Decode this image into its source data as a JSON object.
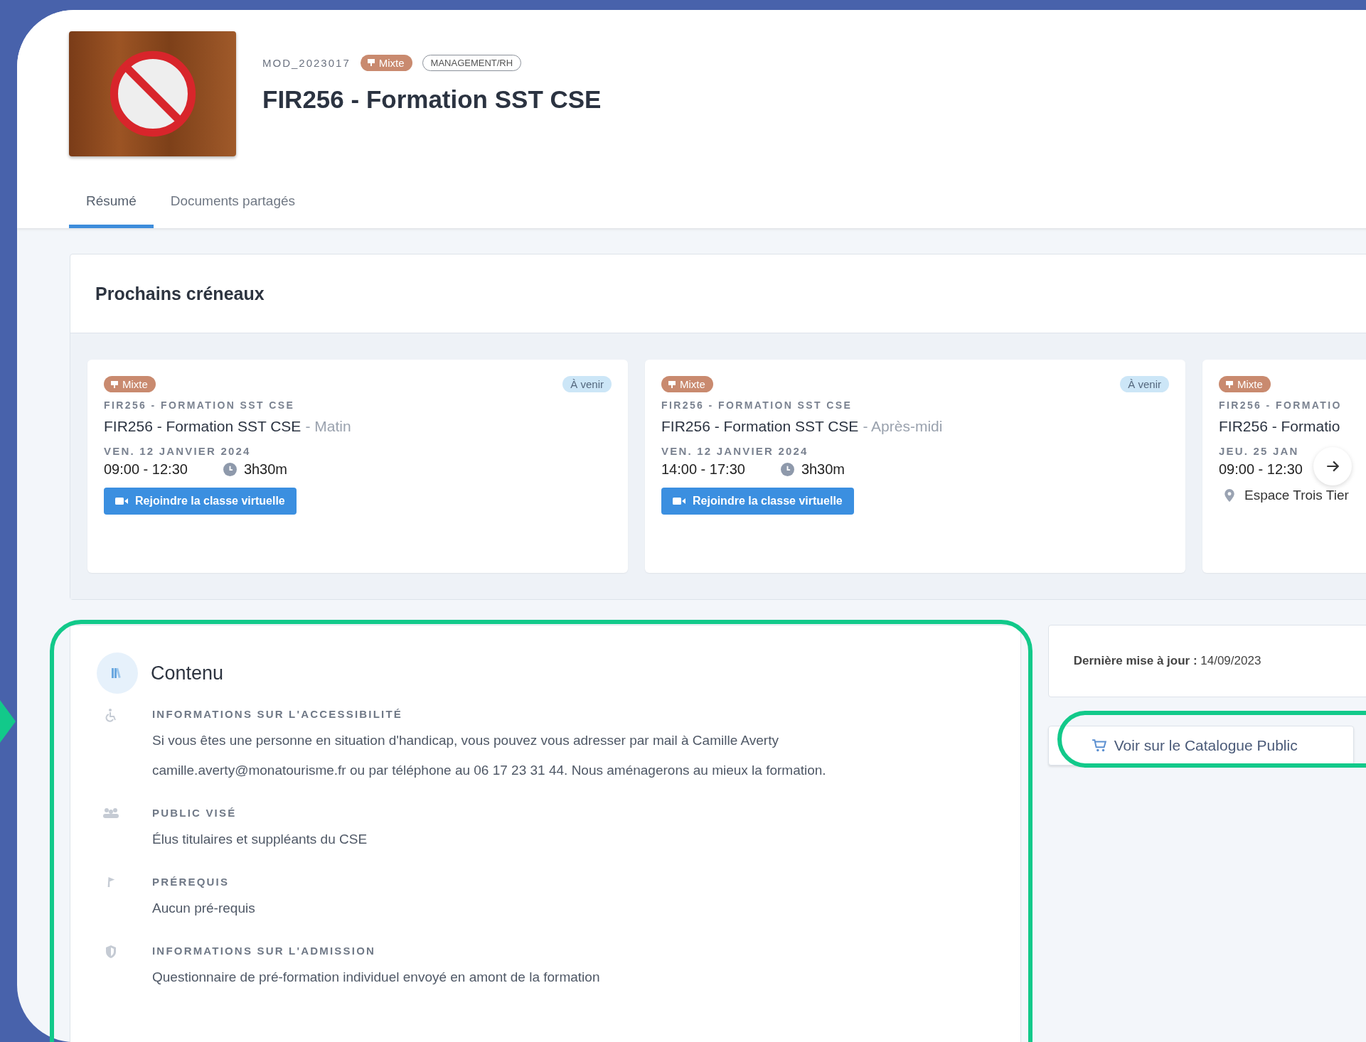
{
  "module": {
    "code": "MOD_2023017",
    "mode": "Mixte",
    "category": "MANAGEMENT/RH",
    "title": "FIR256 - Formation SST CSE"
  },
  "tabs": [
    {
      "label": "Résumé",
      "selected": true
    },
    {
      "label": "Documents partagés",
      "selected": false
    }
  ],
  "upcoming": {
    "title": "Prochains créneaux",
    "sessions": [
      {
        "mode": "Mixte",
        "status": "À venir",
        "code": "FIR256 - FORMATION SST CSE",
        "title": "FIR256 - Formation SST CSE",
        "part": "- Matin",
        "date": "VEN. 12 JANVIER 2024",
        "time": "09:00 - 12:30",
        "duration": "3h30m",
        "action": {
          "kind": "button",
          "label": "Rejoindre la classe virtuelle"
        }
      },
      {
        "mode": "Mixte",
        "status": "À venir",
        "code": "FIR256 - FORMATION SST CSE",
        "title": "FIR256 - Formation SST CSE",
        "part": "- Après-midi",
        "date": "VEN. 12 JANVIER 2024",
        "time": "14:00 - 17:30",
        "duration": "3h30m",
        "action": {
          "kind": "button",
          "label": "Rejoindre la classe virtuelle"
        }
      },
      {
        "mode": "Mixte",
        "code": "FIR256 - FORMATIO",
        "title": "FIR256 - Formatio",
        "date": "JEU. 25 JAN",
        "time": "09:00 - 12:30",
        "action": {
          "kind": "location",
          "label": "Espace Trois Tier"
        }
      }
    ]
  },
  "content": {
    "title": "Contenu",
    "items": [
      {
        "kind": "accessibility",
        "label": "INFORMATIONS SUR L'ACCESSIBILITÉ",
        "text": "Si vous êtes une personne en situation d'handicap, vous pouvez vous adresser par mail à Camille Averty camille.averty@monatourisme.fr ou par téléphone au 06 17 23 31 44. Nous aménagerons au mieux la formation."
      },
      {
        "kind": "audience",
        "label": "PUBLIC VISÉ",
        "text": "Élus titulaires et suppléants du CSE"
      },
      {
        "kind": "prerequisites",
        "label": "PRÉREQUIS",
        "text": "Aucun pré-requis"
      },
      {
        "kind": "admission",
        "label": "INFORMATIONS SUR L'ADMISSION",
        "text": "Questionnaire de pré-formation individuel envoyé en amont de la formation"
      }
    ]
  },
  "last_update": "**Dernière mise à jour :** 14/09/2023",
  "catalogue_button": "Voir sur le Catalogue Public"
}
